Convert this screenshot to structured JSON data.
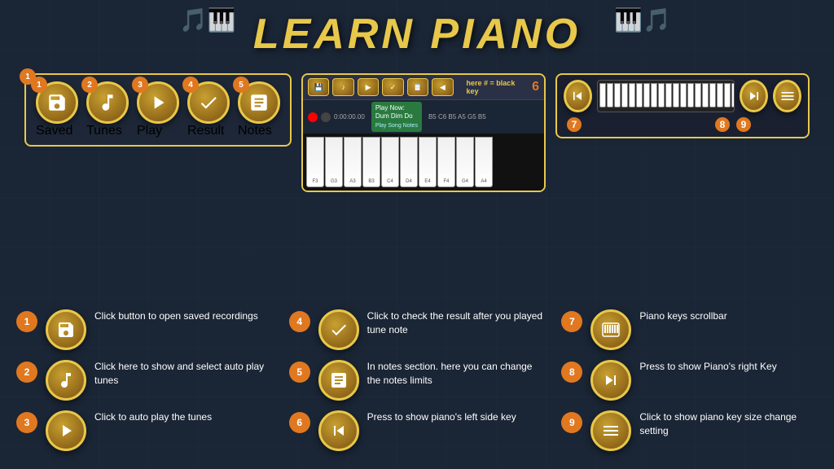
{
  "title": "LEARN PIANO",
  "toolbar": {
    "items": [
      {
        "id": 1,
        "label": "Saved"
      },
      {
        "id": 2,
        "label": "Tunes"
      },
      {
        "id": 3,
        "label": "Play"
      },
      {
        "id": 4,
        "label": "Result"
      },
      {
        "id": 5,
        "label": "Notes"
      }
    ]
  },
  "piano": {
    "play_now_line1": "Play Now:",
    "play_now_line2": "Dum Dim Do",
    "notes_text": "B5 C6 B5 A5 G5 B5",
    "time": "0:00:00.00",
    "label_here": "here # = black key"
  },
  "help_items": [
    {
      "num": "1",
      "text": "Click button to open saved recordings"
    },
    {
      "num": "2",
      "text": "Click here to show and select  auto play tunes"
    },
    {
      "num": "3",
      "text": "Click to auto play the tunes"
    },
    {
      "num": "4",
      "text": "Click to check the result after you played tune note"
    },
    {
      "num": "5",
      "text": "In notes section. here you  can change the notes limits"
    },
    {
      "num": "6",
      "text": "Press to show piano's left side key"
    },
    {
      "num": "7",
      "text": "Piano keys scrollbar"
    },
    {
      "num": "8",
      "text": "Press to show Piano's right Key"
    },
    {
      "num": "9",
      "text": "Click to show  piano key size change setting"
    }
  ],
  "piano_keys": [
    "F3",
    "G3",
    "A3",
    "B3",
    "C4",
    "D4",
    "E4",
    "F4",
    "G4",
    "A4"
  ]
}
